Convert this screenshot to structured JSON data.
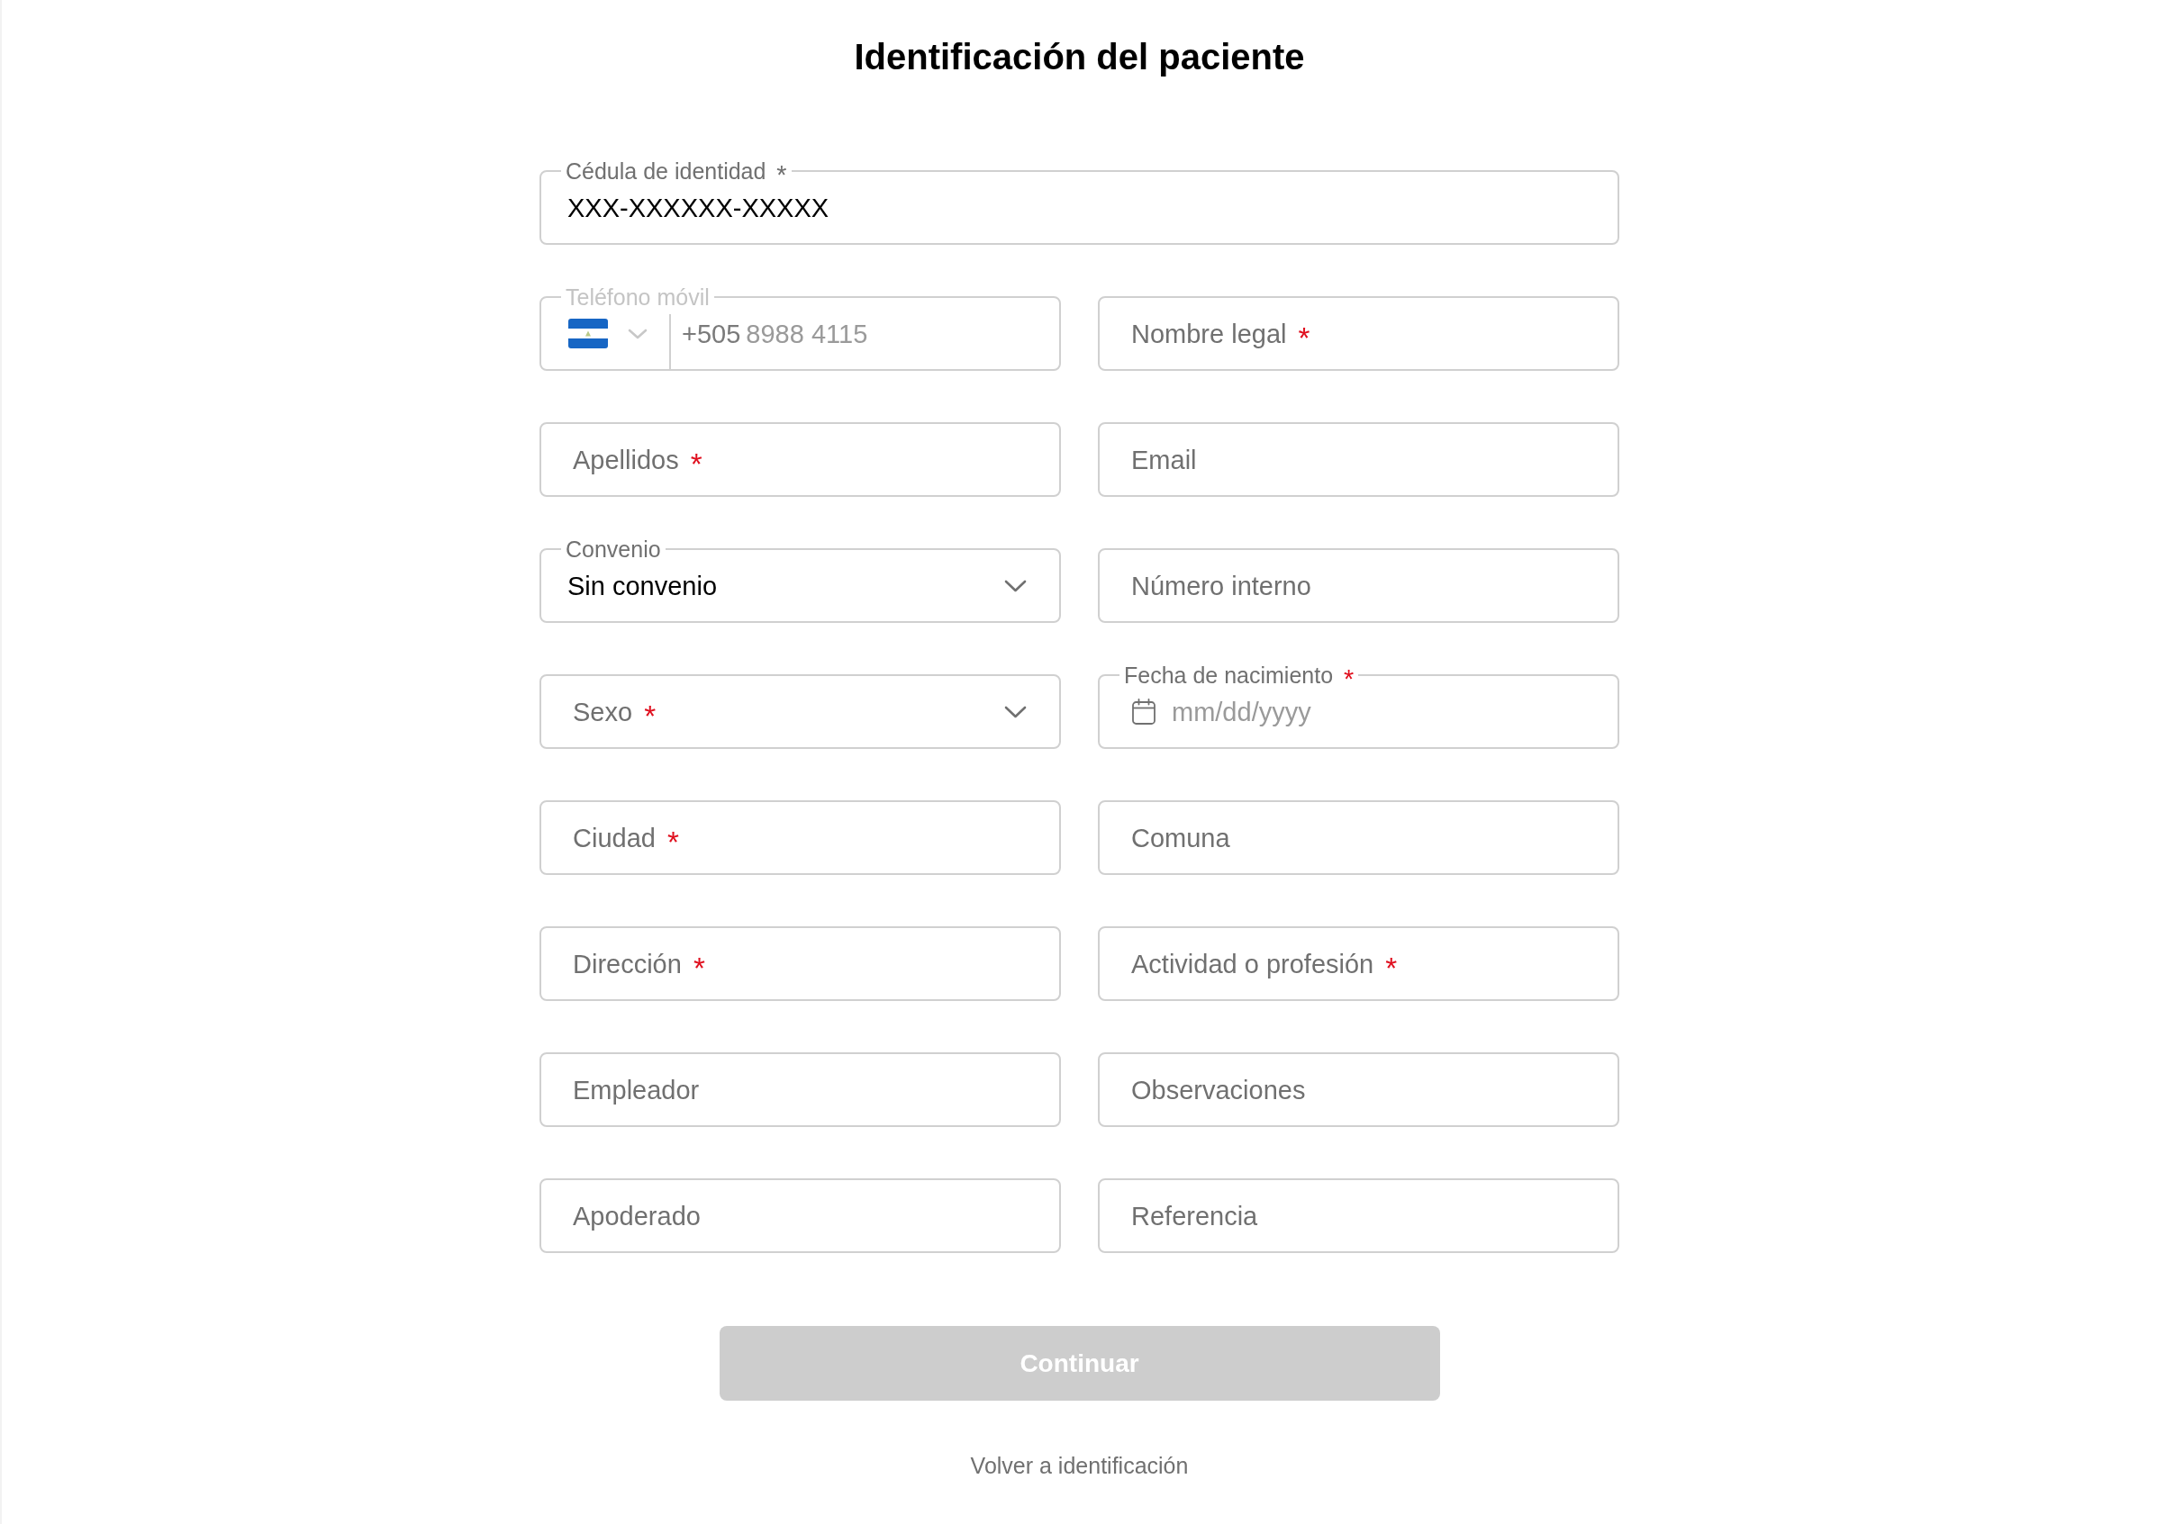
{
  "title": "Identificación del paciente",
  "form": {
    "rows": [
      {
        "fields": [
          {
            "kind": "text",
            "label": "Cédula de identidad",
            "required_mark": "*",
            "value": "XXX-XXXXXX-XXXXX",
            "disabled": false
          }
        ]
      },
      {
        "fields": [
          {
            "kind": "phone",
            "label": "Teléfono móvil",
            "dial_code": "+505",
            "placeholder": "8988 4115",
            "disabled": true
          },
          {
            "kind": "text",
            "label": "Nombre legal",
            "required_mark": "*",
            "disabled": false
          }
        ]
      },
      {
        "fields": [
          {
            "kind": "text",
            "label": "Apellidos",
            "required_mark": "*",
            "disabled": false
          },
          {
            "kind": "text",
            "label": "Email",
            "disabled": false
          }
        ]
      },
      {
        "fields": [
          {
            "kind": "select",
            "label": "Convenio",
            "value": "Sin convenio",
            "disabled": false
          },
          {
            "kind": "text",
            "label": "Número interno",
            "disabled": false
          }
        ]
      },
      {
        "fields": [
          {
            "kind": "select",
            "label": "Sexo",
            "required_mark": "*",
            "disabled": false
          },
          {
            "kind": "date",
            "label": "Fecha de nacimiento",
            "required_mark": "*",
            "placeholder": "mm/dd/yyyy",
            "disabled": false
          }
        ]
      },
      {
        "fields": [
          {
            "kind": "text",
            "label": "Ciudad",
            "required_mark": "*",
            "disabled": false
          },
          {
            "kind": "text",
            "label": "Comuna",
            "disabled": false
          }
        ]
      },
      {
        "fields": [
          {
            "kind": "text",
            "label": "Dirección",
            "required_mark": "*",
            "disabled": false
          },
          {
            "kind": "text",
            "label": "Actividad o profesión",
            "required_mark": "*",
            "disabled": false
          }
        ]
      },
      {
        "fields": [
          {
            "kind": "text",
            "label": "Empleador",
            "disabled": false
          },
          {
            "kind": "text",
            "label": "Observaciones",
            "disabled": false
          }
        ]
      },
      {
        "fields": [
          {
            "kind": "text",
            "label": "Apoderado",
            "disabled": false
          },
          {
            "kind": "text",
            "label": "Referencia",
            "disabled": false
          }
        ]
      }
    ]
  },
  "continue_button": {
    "label": "Continuar",
    "disabled": true
  },
  "back_link": {
    "label": "Volver a identificación"
  }
}
